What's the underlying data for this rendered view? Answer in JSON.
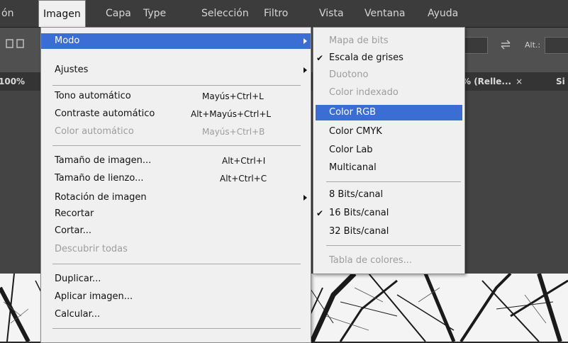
{
  "menubar": {
    "items": [
      "ón",
      "Imagen",
      "Capa",
      "Type",
      "Selección",
      "Filtro",
      "Vista",
      "Ventana",
      "Ayuda"
    ],
    "active": "Imagen"
  },
  "options_bar": {
    "alt_label": "Alt.:",
    "swap_icon": "swap-arrows-icon"
  },
  "tabs": {
    "left_zoom": "100%",
    "doc_tab": "% (Relle...",
    "close": "×",
    "right_fragment": "Si"
  },
  "imagen_menu": {
    "items": [
      {
        "label": "Modo",
        "shortcut": "",
        "submenu": true,
        "highlighted": true,
        "disabled": false
      },
      {
        "label": "Ajustes",
        "shortcut": "",
        "submenu": true,
        "highlighted": false,
        "disabled": false
      },
      {
        "label": "Tono automático",
        "shortcut": "Mayús+Ctrl+L",
        "submenu": false,
        "disabled": false
      },
      {
        "label": "Contraste automático",
        "shortcut": "Alt+Mayús+Ctrl+L",
        "submenu": false,
        "disabled": false
      },
      {
        "label": "Color automático",
        "shortcut": "Mayús+Ctrl+B",
        "submenu": false,
        "disabled": true
      },
      {
        "label": "Tamaño de imagen...",
        "shortcut": "Alt+Ctrl+I",
        "submenu": false,
        "disabled": false
      },
      {
        "label": "Tamaño de lienzo...",
        "shortcut": "Alt+Ctrl+C",
        "submenu": false,
        "disabled": false
      },
      {
        "label": "Rotación de imagen",
        "shortcut": "",
        "submenu": true,
        "disabled": false
      },
      {
        "label": "Recortar",
        "shortcut": "",
        "submenu": false,
        "disabled": false
      },
      {
        "label": "Cortar...",
        "shortcut": "",
        "submenu": false,
        "disabled": false
      },
      {
        "label": "Descubrir todas",
        "shortcut": "",
        "submenu": false,
        "disabled": true
      },
      {
        "label": "Duplicar...",
        "shortcut": "",
        "submenu": false,
        "disabled": false
      },
      {
        "label": "Aplicar imagen...",
        "shortcut": "",
        "submenu": false,
        "disabled": false
      },
      {
        "label": "Calcular...",
        "shortcut": "",
        "submenu": false,
        "disabled": false
      }
    ]
  },
  "modo_submenu": {
    "items": [
      {
        "label": "Mapa de bits",
        "disabled": true,
        "checked": false,
        "highlighted": false
      },
      {
        "label": "Escala de grises",
        "disabled": false,
        "checked": true,
        "highlighted": false
      },
      {
        "label": "Duotono",
        "disabled": true,
        "checked": false,
        "highlighted": false
      },
      {
        "label": "Color indexado",
        "disabled": true,
        "checked": false,
        "highlighted": false
      },
      {
        "label": "Color RGB",
        "disabled": false,
        "checked": false,
        "highlighted": true
      },
      {
        "label": "Color CMYK",
        "disabled": false,
        "checked": false,
        "highlighted": false
      },
      {
        "label": "Color Lab",
        "disabled": false,
        "checked": false,
        "highlighted": false
      },
      {
        "label": "Multicanal",
        "disabled": false,
        "checked": false,
        "highlighted": false
      },
      {
        "label": "8 Bits/canal",
        "disabled": false,
        "checked": false,
        "highlighted": false
      },
      {
        "label": "16 Bits/canal",
        "disabled": false,
        "checked": true,
        "highlighted": false
      },
      {
        "label": "32 Bits/canal",
        "disabled": false,
        "checked": false,
        "highlighted": false
      },
      {
        "label": "Tabla de colores...",
        "disabled": true,
        "checked": false,
        "highlighted": false
      }
    ],
    "check_glyph": "✔"
  },
  "colors": {
    "menu_bg": "#f0f0f0",
    "highlight": "#3a6ed4",
    "disabled_text": "#9d9d9d",
    "menubar_bg": "#3c3c3c"
  }
}
